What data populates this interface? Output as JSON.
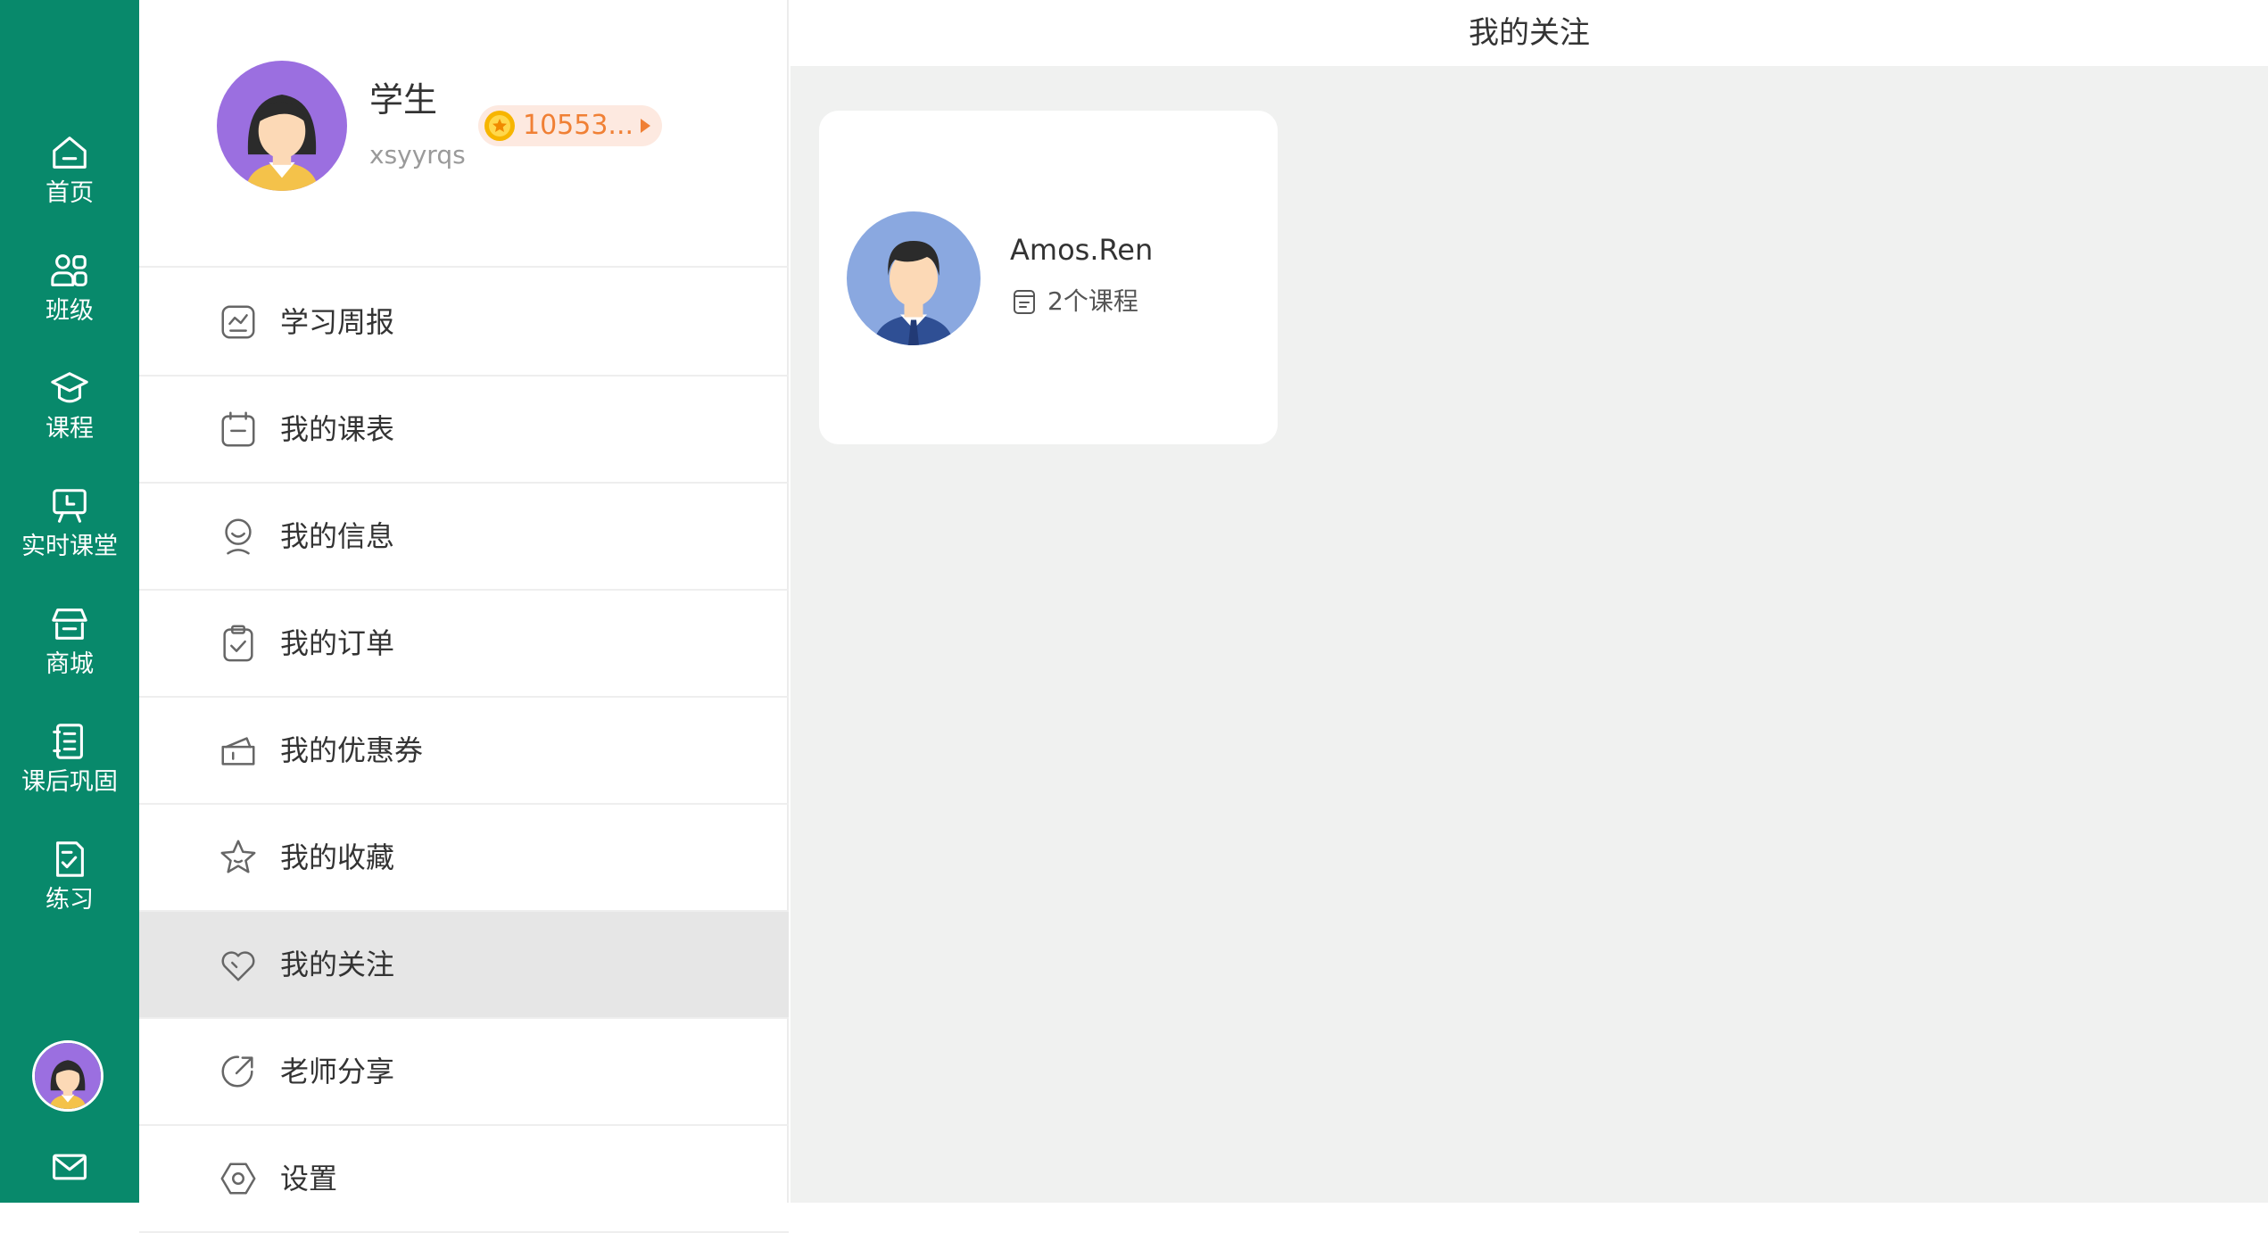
{
  "colors": {
    "rail": "#08896b",
    "menu_active": "#e6e6e6",
    "content_bg": "#f0f1f0",
    "coin_text": "#f08035",
    "coin_bg": "#fde9e0"
  },
  "rail": {
    "items": [
      {
        "label": "首页",
        "icon": "home-icon"
      },
      {
        "label": "班级",
        "icon": "class-icon"
      },
      {
        "label": "课程",
        "icon": "course-icon"
      },
      {
        "label": "实时课堂",
        "icon": "live-class-icon"
      },
      {
        "label": "商城",
        "icon": "shop-icon"
      },
      {
        "label": "课后巩固",
        "icon": "homework-icon"
      },
      {
        "label": "练习",
        "icon": "practice-icon"
      }
    ],
    "bottom_icons": [
      "avatar",
      "mail-icon"
    ]
  },
  "profile": {
    "name": "学生",
    "username": "xsyyrqs",
    "coins": "10553..."
  },
  "menu": {
    "items": [
      {
        "label": "学习周报",
        "icon": "weekly-report-icon"
      },
      {
        "label": "我的课表",
        "icon": "schedule-icon"
      },
      {
        "label": "我的信息",
        "icon": "profile-info-icon"
      },
      {
        "label": "我的订单",
        "icon": "order-icon"
      },
      {
        "label": "我的优惠券",
        "icon": "coupon-icon"
      },
      {
        "label": "我的收藏",
        "icon": "star-icon"
      },
      {
        "label": "我的关注",
        "icon": "heart-icon",
        "active": true
      },
      {
        "label": "老师分享",
        "icon": "share-icon"
      },
      {
        "label": "设置",
        "icon": "settings-icon"
      }
    ]
  },
  "main": {
    "title": "我的关注",
    "followed": [
      {
        "name": "Amos.Ren",
        "courses": "2个课程"
      }
    ]
  }
}
